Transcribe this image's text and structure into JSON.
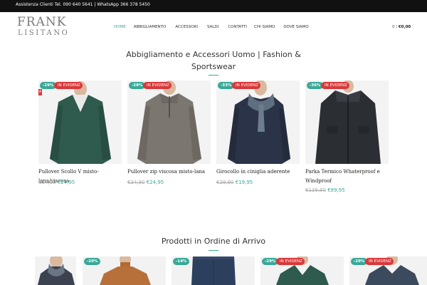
{
  "topbar": {
    "text": "Assistenza Clienti Tel. 090 640 5641 | WhatsApp 366 378 5450"
  },
  "logo": {
    "line1": "FRANK",
    "line2": "LISITANO"
  },
  "nav": {
    "items": [
      {
        "label": "HOME",
        "active": true
      },
      {
        "label": "ABBIGLIAMENTO",
        "active": false
      },
      {
        "label": "ACCESSORI",
        "active": false
      },
      {
        "label": "SALDI",
        "active": false
      },
      {
        "label": "CONTATTI",
        "active": false
      },
      {
        "label": "CHI SIAMO",
        "active": false
      },
      {
        "label": "DOVE SIAMO",
        "active": false
      }
    ]
  },
  "cart": {
    "count": "0",
    "separator": "/",
    "total": "€0,00"
  },
  "featured": {
    "title": "Abbigliamento e Accessori Uomo | Fashion & Sportswear",
    "badge_feature": "IN EVIDENZ",
    "badge_feature_wrap": "A",
    "products": [
      {
        "discount": "-29%",
        "name": "Pullover Scollo V misto-lana/viscosa",
        "old_price": "€34,90",
        "new_price": "€24,95"
      },
      {
        "discount": "-28%",
        "name": "Pullover zip viscosa misto-lana",
        "old_price": "€34,90",
        "new_price": "€24,95"
      },
      {
        "discount": "-33%",
        "name": "Girocollo in ciniglia aderente",
        "old_price": "€29,90",
        "new_price": "€19,95"
      },
      {
        "discount": "-36%",
        "name": "Parka Termico Whaterproof e Windproof",
        "old_price": "€139,90",
        "new_price": "€89,95"
      }
    ]
  },
  "arrivals": {
    "title": "Prodotti in Ordine di Arrivo",
    "products": [
      {
        "discount": "",
        "feature": false
      },
      {
        "discount": "-20%",
        "feature": false
      },
      {
        "discount": "-14%",
        "feature": false
      },
      {
        "discount": "-29%",
        "feature": true,
        "feature_label": "IN EVIDENZ"
      },
      {
        "discount": "-29%",
        "feature": true,
        "feature_label": "IN EVIDENZ"
      }
    ]
  },
  "colors": {
    "accent": "#3aa898",
    "badge_red": "#d9383a",
    "topbar_bg": "#111111"
  }
}
